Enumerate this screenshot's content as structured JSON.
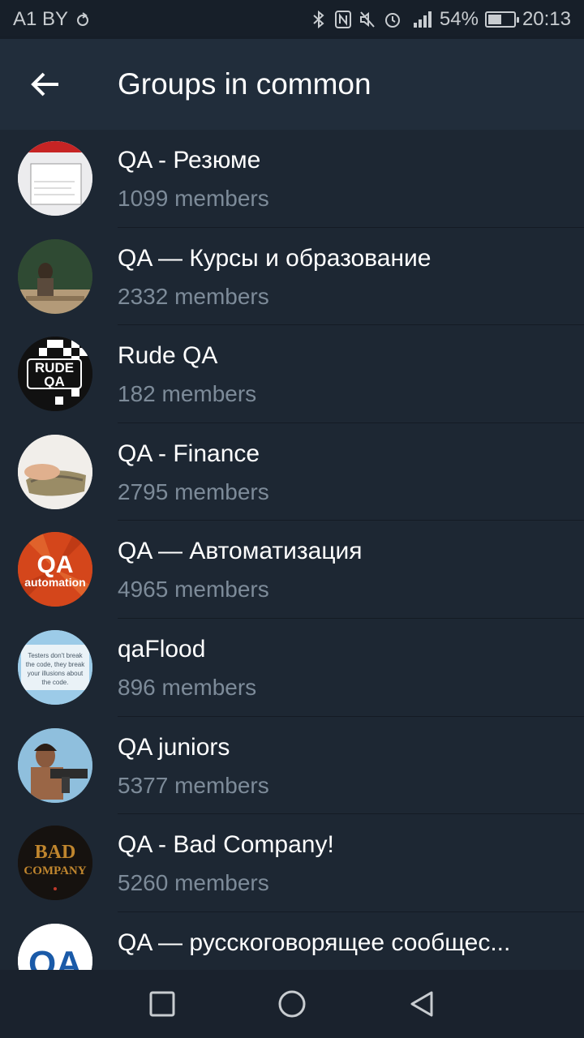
{
  "status_bar": {
    "carrier": "A1 BY",
    "battery": "54%",
    "battery_level": 0.54,
    "time": "20:13",
    "icons": [
      "bluetooth-icon",
      "nfc-icon",
      "mute-icon",
      "alarm-icon",
      "signal-icon",
      "battery-icon"
    ]
  },
  "app_bar": {
    "title": "Groups in common",
    "back_icon": "arrow-left-icon"
  },
  "groups": [
    {
      "name": "QA - Резюме",
      "members": "1099 members",
      "avatar": "resume-photo"
    },
    {
      "name": "QA — Курсы и образование",
      "members": "2332 members",
      "avatar": "classroom-photo"
    },
    {
      "name": "Rude QA",
      "members": "182 members",
      "avatar": "rude-qa-logo",
      "avatar_text": "RUDE QA"
    },
    {
      "name": "QA - Finance",
      "members": "2795 members",
      "avatar": "money-photo"
    },
    {
      "name": "QA — Автоматизация",
      "members": "4965 members",
      "avatar": "qa-automation-logo",
      "avatar_text": [
        "QA",
        "automation"
      ]
    },
    {
      "name": "qaFlood",
      "members": "896 members",
      "avatar": "testers-quote-photo",
      "avatar_text": "Testers don't break the code, they break your illusions about the code."
    },
    {
      "name": "QA juniors",
      "members": "5377 members",
      "avatar": "rambo-photo"
    },
    {
      "name": "QA - Bad Company!",
      "members": "5260 members",
      "avatar": "bad-company-logo",
      "avatar_text": "BAD COMPANY"
    },
    {
      "name": "QA — русскоговорящее сообщес...",
      "members": "",
      "avatar": "qa-logo",
      "avatar_text": "QA"
    }
  ],
  "colors": {
    "background": "#1d2733",
    "app_bar": "#212d3b",
    "secondary_text": "#7d8b99",
    "nav_bar": "#1a222d"
  },
  "nav_bar": {
    "buttons": [
      "recent-apps-icon",
      "home-icon",
      "back-icon"
    ]
  }
}
